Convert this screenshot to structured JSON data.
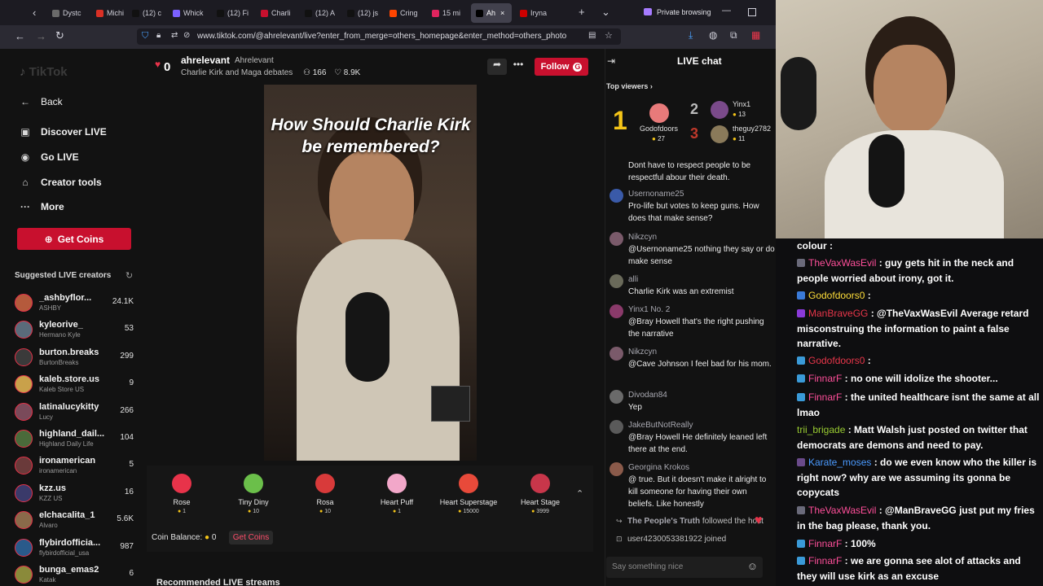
{
  "browser": {
    "tabs": [
      {
        "label": "Dystc",
        "color": "#6a6a6a"
      },
      {
        "label": "Michi",
        "color": "#d93025"
      },
      {
        "label": "(12) c",
        "color": "#111111"
      },
      {
        "label": "Whick",
        "color": "#7b61ff"
      },
      {
        "label": "(12) Fi",
        "color": "#111111"
      },
      {
        "label": "Charli",
        "color": "#c8102e"
      },
      {
        "label": "(12) A",
        "color": "#111111"
      },
      {
        "label": "(12) js",
        "color": "#111111"
      },
      {
        "label": "Cring",
        "color": "#ff4500"
      },
      {
        "label": "15 mi",
        "color": "#e0245e"
      },
      {
        "label": "Ah",
        "color": "#000000"
      },
      {
        "label": "Iryna",
        "color": "#cc0000"
      }
    ],
    "private_label": "Private browsing",
    "url": "www.tiktok.com/@ahrelevant/live?enter_from_merge=others_homepage&enter_method=others_photo"
  },
  "sidebar": {
    "logo": "TikTok",
    "nav": [
      {
        "label": "Back",
        "icon": "←"
      },
      {
        "label": "Discover LIVE",
        "icon": "▣"
      },
      {
        "label": "Go LIVE",
        "icon": "◉"
      },
      {
        "label": "Creator tools",
        "icon": "⌂"
      },
      {
        "label": "More",
        "icon": "···"
      }
    ],
    "get_coins": "Get Coins",
    "suggested_title": "Suggested LIVE creators",
    "creators": [
      {
        "name": "_ashbyflor...",
        "sub": "ASHBY",
        "count": "24.1K",
        "color": "#b55a3c"
      },
      {
        "name": "kyleorive_",
        "sub": "Hermano Kyle",
        "count": "53",
        "color": "#5a6b7a"
      },
      {
        "name": "burton.breaks",
        "sub": "BurtonBreaks",
        "count": "299",
        "color": "#3a3a3a"
      },
      {
        "name": "kaleb.store.us",
        "sub": "Kaleb Store US",
        "count": "9",
        "color": "#c9a14a"
      },
      {
        "name": "latinalucykitty",
        "sub": "Lucy",
        "count": "266",
        "color": "#7a4a5a"
      },
      {
        "name": "highland_dail...",
        "sub": "Highland Daily Life",
        "count": "104",
        "color": "#4a6a3a"
      },
      {
        "name": "ironamerican",
        "sub": "ironamerican",
        "count": "5",
        "color": "#6a3a3a"
      },
      {
        "name": "kzz.us",
        "sub": "KZZ US",
        "count": "16",
        "color": "#3a3a6a"
      },
      {
        "name": "elchacalita_1",
        "sub": "Alvaro",
        "count": "5.6K",
        "color": "#8a6a4a"
      },
      {
        "name": "flybirdofficia...",
        "sub": "flybirdofficial_usa",
        "count": "987",
        "color": "#2a5a8a"
      },
      {
        "name": "bunga_emas2",
        "sub": "Katak",
        "count": "6",
        "color": "#8a8a3a"
      }
    ]
  },
  "stream": {
    "likes_badge": "0",
    "username": "ahrelevant",
    "display_name": "Ahrelevant",
    "title": "Charlie Kirk and Maga debates",
    "viewers": "166",
    "likes": "8.9K",
    "follow": "Follow",
    "caption": "How Should Charlie Kirk be remembered?",
    "gifts": [
      {
        "name": "Rose",
        "cost": "1",
        "color": "#e8334a"
      },
      {
        "name": "Tiny Diny",
        "cost": "10",
        "color": "#6bbf4a"
      },
      {
        "name": "Rosa",
        "cost": "10",
        "color": "#d83a3a"
      },
      {
        "name": "Heart Puff",
        "cost": "1",
        "color": "#f2a7c9"
      },
      {
        "name": "Heart Superstage",
        "cost": "15000",
        "color": "#e84a3a"
      },
      {
        "name": "Heart Stage",
        "cost": "3999",
        "color": "#c8364a"
      }
    ],
    "coin_balance_label": "Coin Balance:",
    "coin_balance": "0",
    "get_coins": "Get Coins",
    "recommended": "Recommended LIVE streams"
  },
  "live_chat": {
    "title": "LIVE chat",
    "top_viewers": "Top viewers",
    "rank1": {
      "name": "Godofdoors",
      "coins": "27"
    },
    "rank2": {
      "name": "Yinx1",
      "coins": "13"
    },
    "rank3": {
      "name": "theguy2782",
      "coins": "11"
    },
    "messages": [
      {
        "name": "",
        "text": "Dont have to respect people to be respectful abour their death.",
        "color": "#5a5a5a"
      },
      {
        "name": "Usernoname25",
        "text": "Pro-life but votes to keep guns. How does that make sense?",
        "color": "#3a5aa8"
      },
      {
        "name": "Nikzcyn",
        "text": "@Usernoname25 nothing they say or do make sense",
        "color": "#7a5a6a"
      },
      {
        "name": "alli",
        "text": "Charlie Kirk was an extremist",
        "color": "#6a6a5a"
      },
      {
        "name": "Yinx1  No. 2",
        "text": "@Bray Howell that's the right pushing the narrative",
        "color": "#8a3a6a"
      },
      {
        "name": "Nikzcyn",
        "text": "@Cave Johnson I feel bad for his mom.",
        "color": "#7a5a6a"
      },
      {
        "name": "Divodan84",
        "text": "Yep",
        "color": "#6a6a6a"
      },
      {
        "name": "JakeButNotReally",
        "text": "@Bray Howell He definitely leaned left there at the end.",
        "color": "#5a5a5a"
      },
      {
        "name": "Georgina Krokos",
        "text": "@ true. But it doesn't make it alright to kill someone for having their own beliefs. Like honestly",
        "color": "#8a5a4a"
      }
    ],
    "follow_notice_name": "The People's Truth",
    "follow_notice": "followed the host",
    "join_notice": "user4230053381922 joined",
    "input_placeholder": "Say something nice"
  },
  "twitch_chat": [
    {
      "user": "",
      "text": "colour :",
      "color": "#ffffff",
      "badge": ""
    },
    {
      "user": "TheVaxWasEvil",
      "text": ": guy gets hit in the neck and people worried about irony, got it.",
      "color": "#ff4f9a",
      "badge": "#6a6a7a"
    },
    {
      "user": "Godofdoors0",
      "text": ":",
      "color": "#ffde3a",
      "badge": "#3a7ad8"
    },
    {
      "user": "ManBraveGG",
      "text": ": @TheVaxWasEvil Average retard misconstruing the information to paint a false narrative.",
      "color": "#e8364a",
      "badge": "#8a3ad8"
    },
    {
      "user": "Godofdoors0",
      "text": ":",
      "color": "#e8364a",
      "badge": "#3a9ad8"
    },
    {
      "user": "FinnarF",
      "text": ": no one will idolize the shooter...",
      "color": "#ff4f9a",
      "badge": "#3a9ad8"
    },
    {
      "user": "FinnarF",
      "text": ": the united healthcare isnt the same at all lmao",
      "color": "#ff4f9a",
      "badge": "#3a9ad8"
    },
    {
      "user": "trii_brigade",
      "text": ": Matt Walsh just posted on twitter that democrats are demons and need to pay.",
      "color": "#9acd32",
      "badge": ""
    },
    {
      "user": "Karate_moses",
      "text": ": do we even know who the killer is right now? why are we assuming its gonna be copycats",
      "color": "#4a9aff",
      "badge": "#6a4a8a"
    },
    {
      "user": "TheVaxWasEvil",
      "text": ": @ManBraveGG just put my fries in the bag please, thank you.",
      "color": "#ff4f9a",
      "badge": "#6a6a7a"
    },
    {
      "user": "FinnarF",
      "text": ": 100%",
      "color": "#ff4f9a",
      "badge": "#3a9ad8"
    },
    {
      "user": "FinnarF",
      "text": ": we are gonna see alot of attacks and they will use kirk as an excuse",
      "color": "#ff4f9a",
      "badge": "#3a9ad8"
    }
  ],
  "colors": {
    "accent": "#c8102e",
    "chat_bg": "#121212",
    "twitch_bg": "#0e0e10"
  }
}
